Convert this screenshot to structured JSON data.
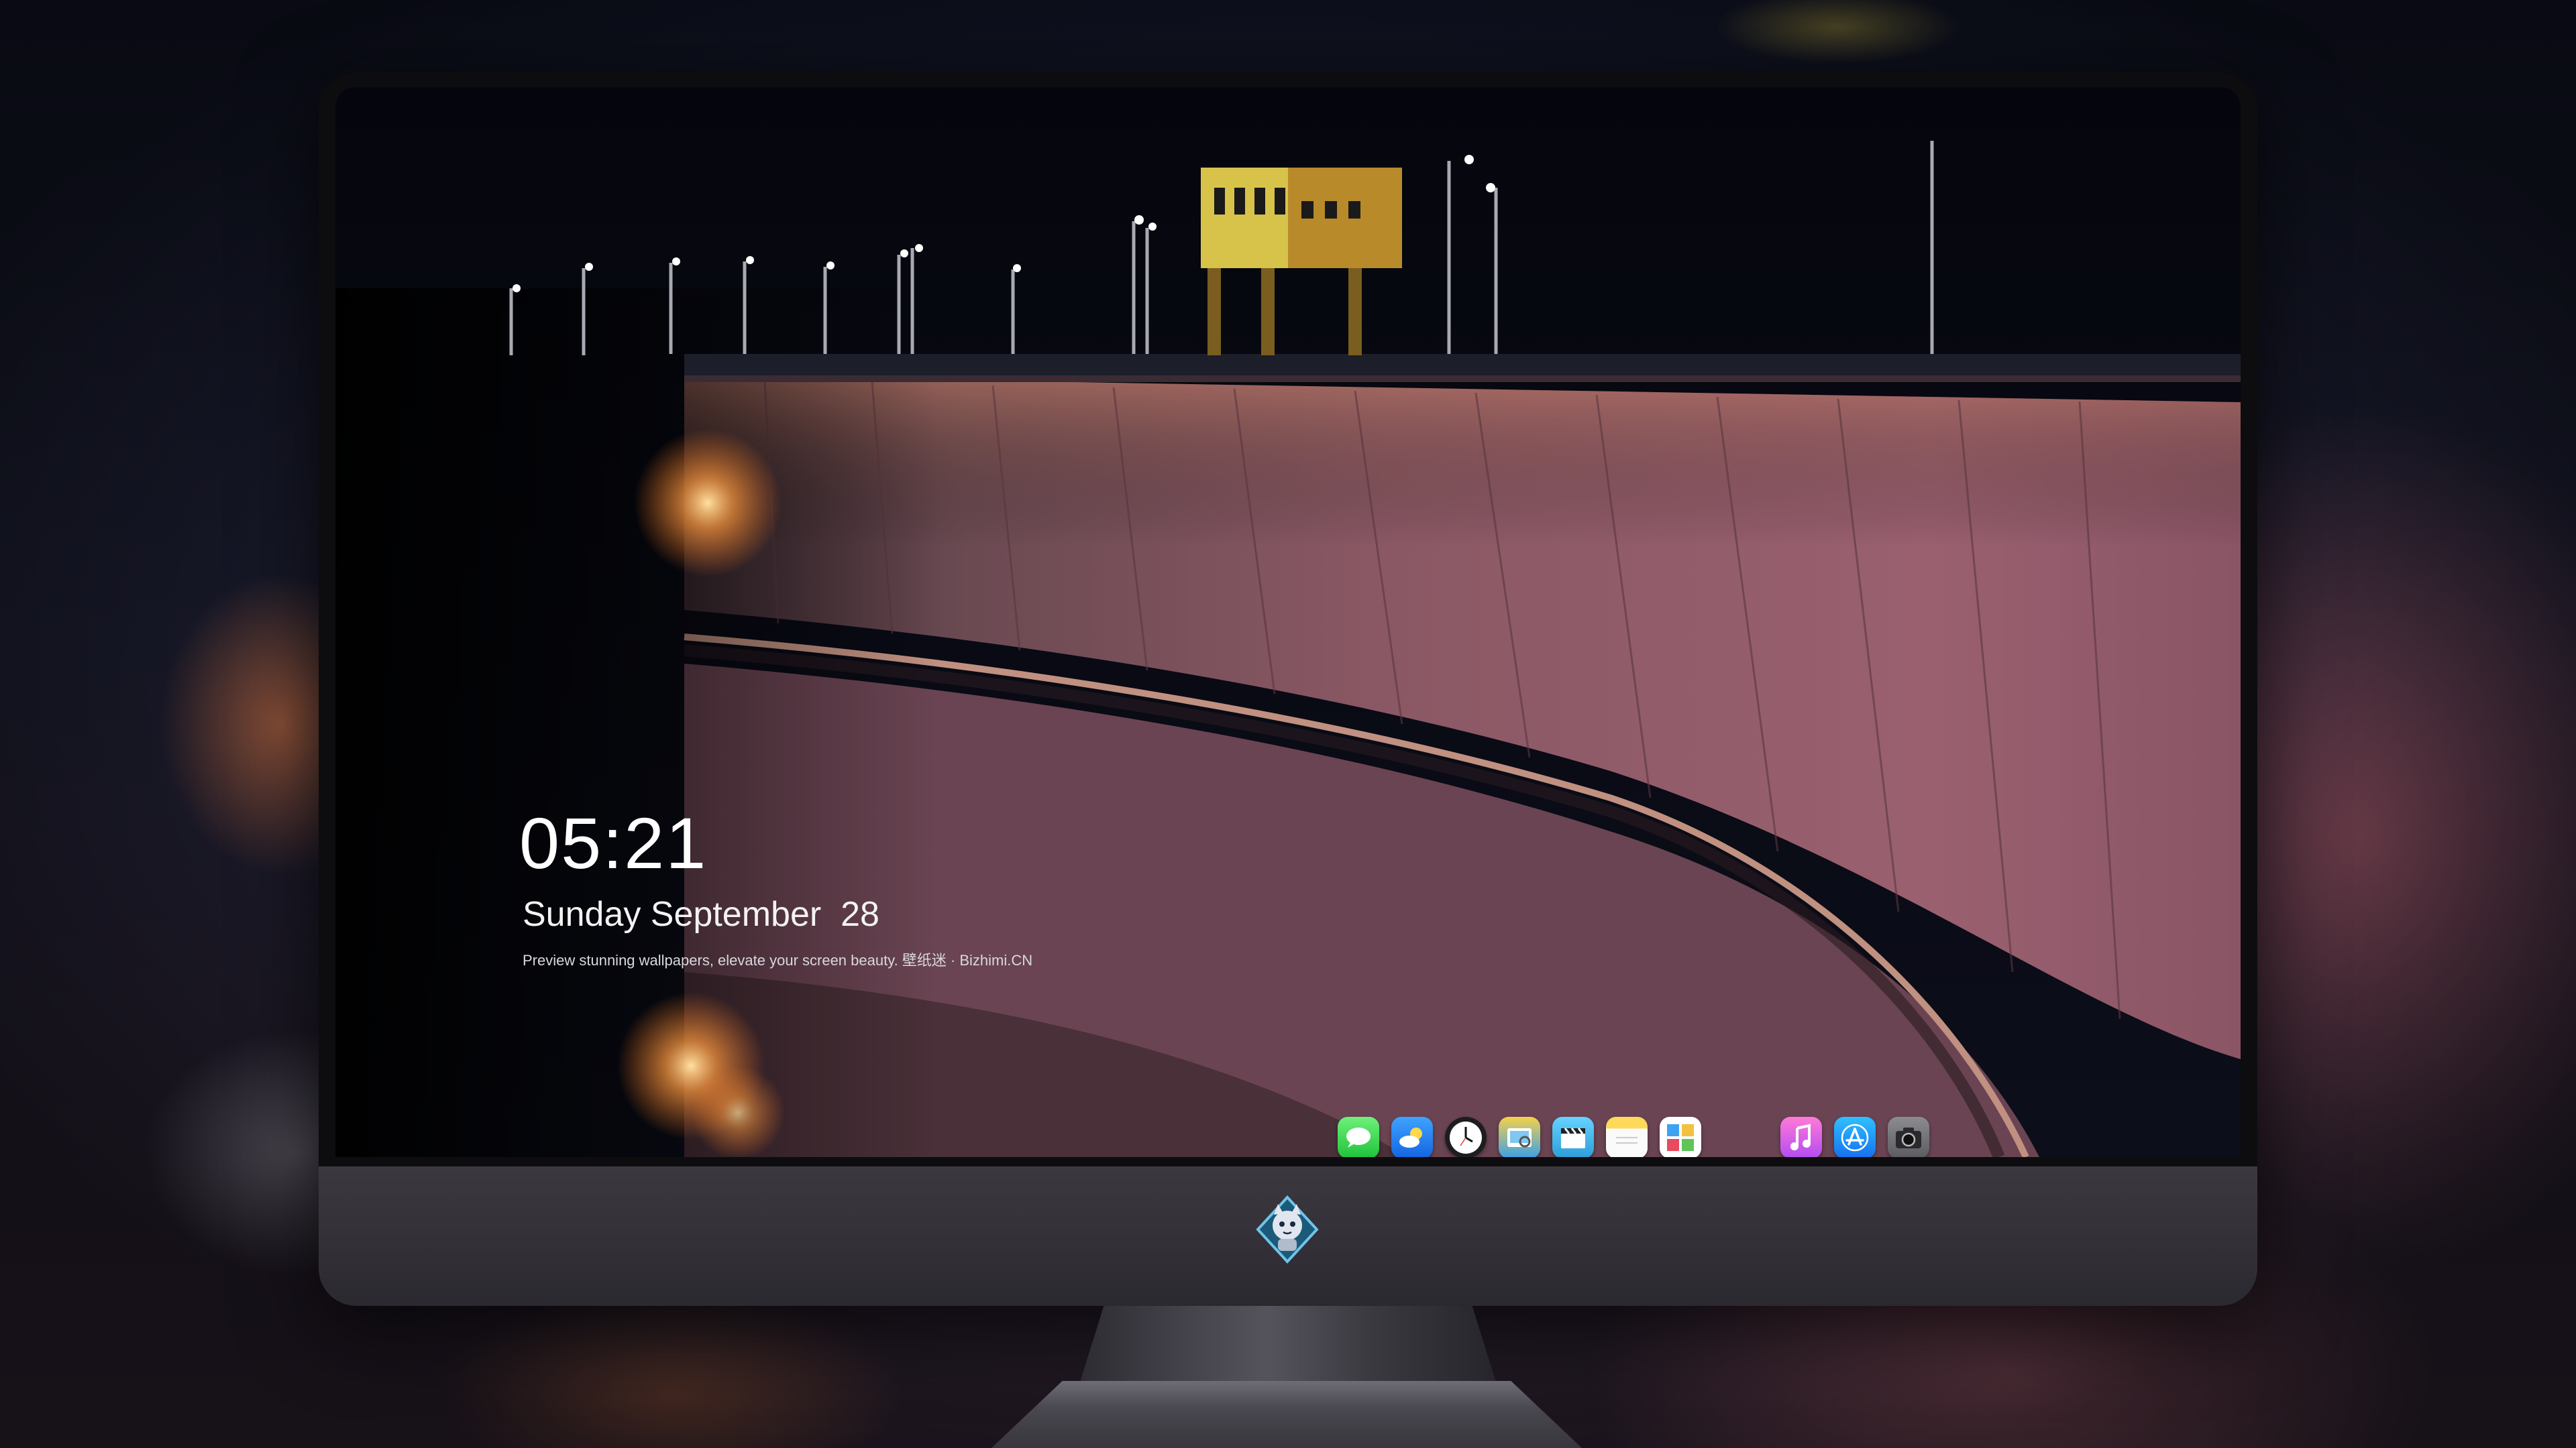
{
  "lockscreen": {
    "time": "05:21",
    "date": "Sunday September  28",
    "tagline": "Preview stunning wallpapers, elevate your screen beauty. 壁纸迷 · Bizhimi.CN"
  },
  "dock": {
    "apps": [
      {
        "name": "Messages",
        "icon": "messages-icon"
      },
      {
        "name": "Weather",
        "icon": "weather-icon"
      },
      {
        "name": "Clock",
        "icon": "clock-icon"
      },
      {
        "name": "Preview",
        "icon": "preview-icon"
      },
      {
        "name": "Clips",
        "icon": "clapperboard-icon"
      },
      {
        "name": "Notes",
        "icon": "notes-icon"
      },
      {
        "name": "Photos",
        "icon": "photos-icon"
      },
      {
        "name": "Music",
        "icon": "music-note-icon"
      },
      {
        "name": "App Store",
        "icon": "app-store-icon"
      },
      {
        "name": "Camera",
        "icon": "camera-icon"
      }
    ]
  },
  "colors": {
    "dam_wall": "#8a5561",
    "sky": "#05060d",
    "chin": "#3a373f",
    "lamp_glow": "#ffb15a"
  }
}
